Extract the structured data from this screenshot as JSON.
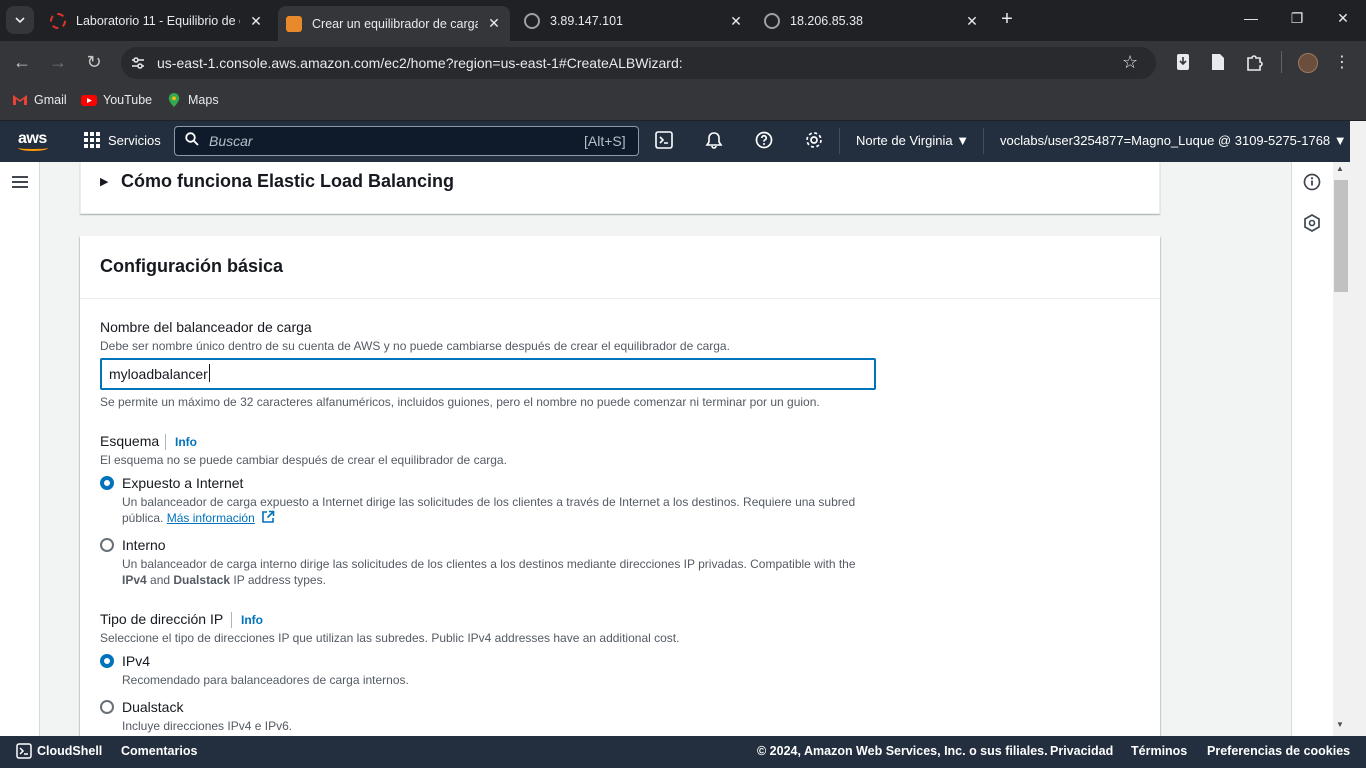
{
  "browser": {
    "tabs": [
      {
        "title": "Laboratorio 11 - Equilibrio de c",
        "active": false
      },
      {
        "title": "Crear un equilibrador de carga",
        "active": true
      },
      {
        "title": "3.89.147.101",
        "active": false
      },
      {
        "title": "18.206.85.38",
        "active": false
      }
    ],
    "url": "us-east-1.console.aws.amazon.com/ec2/home?region=us-east-1#CreateALBWizard:",
    "bookmarks": [
      "Gmail",
      "YouTube",
      "Maps"
    ]
  },
  "aws_nav": {
    "logo": "aws",
    "services": "Servicios",
    "search_placeholder": "Buscar",
    "search_shortcut": "[Alt+S]",
    "region": "Norte de Virginia ▼",
    "account": "voclabs/user3254877=Magno_Luque @ 3109-5275-1768 ▼"
  },
  "how_section": {
    "caret": "▶",
    "title": "Cómo funciona Elastic Load Balancing"
  },
  "basic_config": {
    "title": "Configuración básica",
    "name_label": "Nombre del balanceador de carga",
    "name_desc": "Debe ser nombre único dentro de su cuenta de AWS y no puede cambiarse después de crear el equilibrador de carga.",
    "name_value": "myloadbalancer",
    "name_hint": "Se permite un máximo de 32 caracteres alfanuméricos, incluidos guiones, pero el nombre no puede comenzar ni terminar por un guion.",
    "scheme_label": "Esquema",
    "scheme_info": "Info",
    "scheme_desc": "El esquema no se puede cambiar después de crear el equilibrador de carga.",
    "scheme_options": [
      {
        "label": "Expuesto a Internet",
        "selected": true,
        "desc_line1": "Un balanceador de carga expuesto a Internet dirige las solicitudes de los clientes a través de Internet a los destinos. Requiere una subred",
        "desc_line2": "pública.",
        "link": "Más información"
      },
      {
        "label": "Interno",
        "selected": false,
        "desc_line1": "Un balanceador de carga interno dirige las solicitudes de los clientes a los destinos mediante direcciones IP privadas. Compatible with the",
        "desc_ipv4": "IPv4",
        "desc_and": " and ",
        "desc_dual": "Dualstack",
        "desc_tail": " IP address types."
      }
    ],
    "ip_label": "Tipo de dirección IP",
    "ip_info": "Info",
    "ip_desc": "Seleccione el tipo de direcciones IP que utilizan las subredes. Public IPv4 addresses have an additional cost.",
    "ip_options": [
      {
        "label": "IPv4",
        "selected": true,
        "desc": "Recomendado para balanceadores de carga internos."
      },
      {
        "label": "Dualstack",
        "selected": false,
        "desc": "Incluye direcciones IPv4 e IPv6."
      }
    ]
  },
  "footer": {
    "cloudshell": "CloudShell",
    "feedback": "Comentarios",
    "copyright": "© 2024, Amazon Web Services, Inc. o sus filiales.",
    "privacy": "Privacidad",
    "terms": "Términos",
    "cookies": "Preferencias de cookies"
  },
  "colors": {
    "aws_nav_bg": "#232f3e",
    "accent_blue": "#0073bb",
    "aws_orange": "#ff9900"
  }
}
